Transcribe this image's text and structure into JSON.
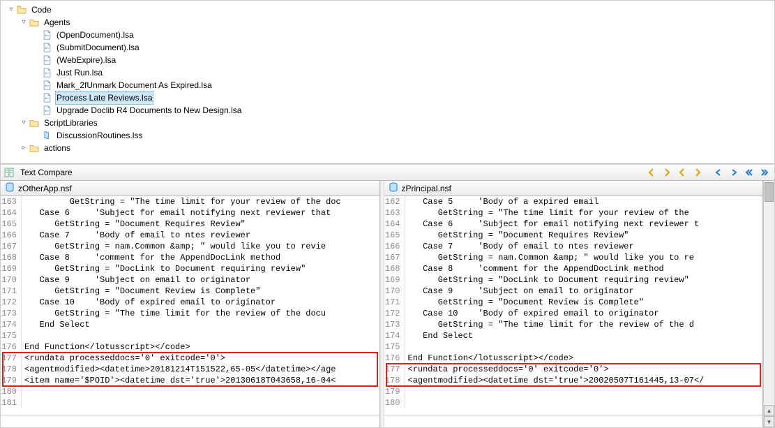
{
  "tree": {
    "root_label": "Code",
    "agents_label": "Agents",
    "agents_items": [
      "(OpenDocument).lsa",
      "(SubmitDocument).lsa",
      "(WebExpire).lsa",
      "Just Run.lsa",
      "Mark_2fUnmark Document As Expired.lsa",
      "Process Late Reviews.lsa",
      "Upgrade Doclib R4 Documents to New Design.lsa"
    ],
    "selected_agent_index": 5,
    "scriptlibs_label": "ScriptLibraries",
    "scriptlibs_items": [
      "DiscussionRoutines.lss"
    ],
    "actions_label": "actions"
  },
  "compare": {
    "title": "Text Compare",
    "left_title": "zOtherApp.nsf",
    "right_title": "zPrincipal.nsf"
  },
  "left_lines": [
    {
      "n": "163",
      "t": "         GetString = \"The time limit for your review of the doc"
    },
    {
      "n": "164",
      "t": "   Case 6     'Subject for email notifying next reviewer that"
    },
    {
      "n": "165",
      "t": "      GetString = \"Document Requires Review\""
    },
    {
      "n": "166",
      "t": "   Case 7     'Body of email to ntes reviewer"
    },
    {
      "n": "167",
      "t": "      GetString = nam.Common &amp; \" would like you to revie"
    },
    {
      "n": "168",
      "t": "   Case 8     'comment for the AppendDocLink method"
    },
    {
      "n": "169",
      "t": "      GetString = \"DocLink to Document requiring review\""
    },
    {
      "n": "170",
      "t": "   Case 9     'Subject on email to originator"
    },
    {
      "n": "171",
      "t": "      GetString = \"Document Review is Complete\""
    },
    {
      "n": "172",
      "t": "   Case 10    'Body of expired email to originator"
    },
    {
      "n": "173",
      "t": "      GetString = \"The time limit for the review of the docu"
    },
    {
      "n": "174",
      "t": "   End Select"
    },
    {
      "n": "175",
      "t": ""
    },
    {
      "n": "176",
      "t": "End Function</lotusscript></code>"
    },
    {
      "n": "177",
      "t": "<rundata processeddocs='0' exitcode='0'>"
    },
    {
      "n": "178",
      "t": "<agentmodified><datetime>20181214T151522,65-05</datetime></age"
    },
    {
      "n": "179",
      "t": "<item name='$POID'><datetime dst='true'>20130618T043658,16-04<"
    },
    {
      "n": "180",
      "t": ""
    },
    {
      "n": "181",
      "t": ""
    }
  ],
  "right_lines": [
    {
      "n": "162",
      "t": "   Case 5     'Body of a expired email"
    },
    {
      "n": "163",
      "t": "      GetString = \"The time limit for your review of the"
    },
    {
      "n": "164",
      "t": "   Case 6     'Subject for email notifying next reviewer t"
    },
    {
      "n": "165",
      "t": "      GetString = \"Document Requires Review\""
    },
    {
      "n": "166",
      "t": "   Case 7     'Body of email to ntes reviewer"
    },
    {
      "n": "167",
      "t": "      GetString = nam.Common &amp; \" would like you to re"
    },
    {
      "n": "168",
      "t": "   Case 8     'comment for the AppendDocLink method"
    },
    {
      "n": "169",
      "t": "      GetString = \"DocLink to Document requiring review\""
    },
    {
      "n": "170",
      "t": "   Case 9     'Subject on email to originator"
    },
    {
      "n": "171",
      "t": "      GetString = \"Document Review is Complete\""
    },
    {
      "n": "172",
      "t": "   Case 10    'Body of expired email to originator"
    },
    {
      "n": "173",
      "t": "      GetString = \"The time limit for the review of the d"
    },
    {
      "n": "174",
      "t": "   End Select"
    },
    {
      "n": "175",
      "t": ""
    },
    {
      "n": "176",
      "t": "End Function</lotusscript></code>"
    },
    {
      "n": "177",
      "t": "<rundata processeddocs='0' exitcode='0'>"
    },
    {
      "n": "178",
      "t": "<agentmodified><datetime dst='true'>20020507T161445,13-07</"
    },
    {
      "n": "179",
      "t": ""
    },
    {
      "n": "180",
      "t": ""
    }
  ],
  "toolbar_icons": [
    "prev-diff-icon",
    "next-diff-icon",
    "prev-change-icon",
    "next-change-icon",
    "sep",
    "copy-left-icon",
    "copy-right-icon",
    "copy-all-left-icon",
    "copy-all-right-icon"
  ]
}
